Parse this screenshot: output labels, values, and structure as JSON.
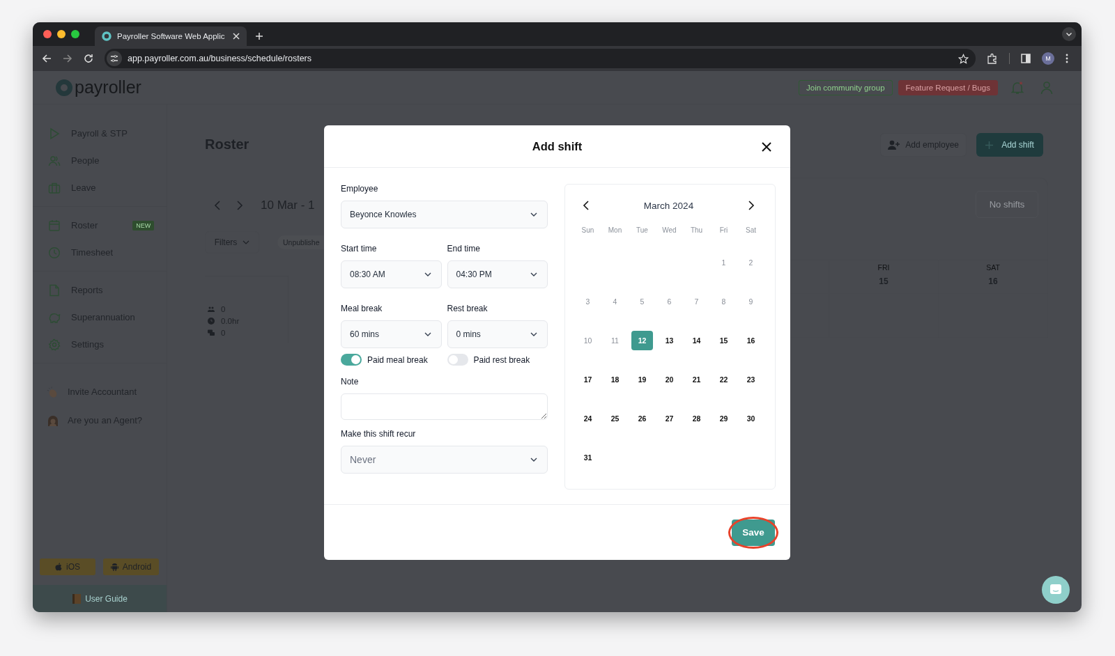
{
  "browser": {
    "tab_title": "Payroller Software Web Applic",
    "url": "app.payroller.com.au/business/schedule/rosters",
    "profile_initial": "M"
  },
  "topbar": {
    "logo": "payroller",
    "buttons": [
      {
        "label": "Join community group",
        "kind": "outline"
      },
      {
        "label": "Feature Request / Bugs",
        "kind": "danger"
      }
    ]
  },
  "sidebar": {
    "sections": [
      {
        "items": [
          {
            "label": "Payroll & STP"
          },
          {
            "label": "People"
          },
          {
            "label": "Leave"
          }
        ]
      },
      {
        "items": [
          {
            "label": "Roster",
            "badge": "NEW"
          },
          {
            "label": "Timesheet"
          }
        ]
      },
      {
        "items": [
          {
            "label": "Reports"
          },
          {
            "label": "Superannuation"
          },
          {
            "label": "Settings"
          }
        ]
      },
      {
        "items": [
          {
            "label": "Invite Accountant"
          },
          {
            "label": "Are you an Agent?"
          }
        ]
      }
    ],
    "apps": [
      "iOS",
      "Android"
    ],
    "guide": "User Guide"
  },
  "roster": {
    "title": "Roster",
    "date_range": "10 Mar - 1",
    "filters": "Filters",
    "chip": "Unpublishe",
    "stats": [
      "0",
      "0.0hr",
      "0"
    ],
    "add_employee": "Add employee",
    "add_shift": "Add shift",
    "empty": "No shifts",
    "days": [
      {
        "dow": "FRI",
        "date": "15"
      },
      {
        "dow": "SAT",
        "date": "16"
      }
    ]
  },
  "modal": {
    "title": "Add shift",
    "employee": {
      "label": "Employee",
      "value": "Beyonce Knowles"
    },
    "times": [
      {
        "label": "Start time",
        "value": "08:30 AM"
      },
      {
        "label": "End time",
        "value": "04:30 PM"
      }
    ],
    "breaks": [
      {
        "label": "Meal break",
        "value": "60 mins"
      },
      {
        "label": "Rest break",
        "value": "0 mins"
      }
    ],
    "toggles": [
      {
        "label": "Paid meal break",
        "on": true
      },
      {
        "label": "Paid rest break",
        "on": false
      }
    ],
    "note": {
      "label": "Note"
    },
    "recur": {
      "label": "Make this shift recur",
      "placeholder": "Never"
    },
    "calendar": {
      "month": "March 2024",
      "weekdays": [
        "Sun",
        "Mon",
        "Tue",
        "Wed",
        "Thu",
        "Fri",
        "Sat"
      ],
      "weeks": [
        {
          "right_aligned": true,
          "days": [
            {
              "d": "1",
              "past": true,
              "selected": false
            },
            {
              "d": "2",
              "past": true,
              "selected": false
            }
          ]
        },
        {
          "days": [
            {
              "d": "3",
              "past": true,
              "selected": false
            },
            {
              "d": "4",
              "past": true,
              "selected": false
            },
            {
              "d": "5",
              "past": true,
              "selected": false
            },
            {
              "d": "6",
              "past": true,
              "selected": false
            },
            {
              "d": "7",
              "past": true,
              "selected": false
            },
            {
              "d": "8",
              "past": true,
              "selected": false
            },
            {
              "d": "9",
              "past": true,
              "selected": false
            }
          ]
        },
        {
          "days": [
            {
              "d": "10",
              "past": true,
              "selected": false
            },
            {
              "d": "11",
              "past": true,
              "selected": false
            },
            {
              "d": "12",
              "past": false,
              "selected": true
            },
            {
              "d": "13",
              "past": false,
              "selected": false
            },
            {
              "d": "14",
              "past": false,
              "selected": false
            },
            {
              "d": "15",
              "past": false,
              "selected": false
            },
            {
              "d": "16",
              "past": false,
              "selected": false
            }
          ]
        },
        {
          "days": [
            {
              "d": "17",
              "past": false,
              "selected": false
            },
            {
              "d": "18",
              "past": false,
              "selected": false
            },
            {
              "d": "19",
              "past": false,
              "selected": false
            },
            {
              "d": "20",
              "past": false,
              "selected": false
            },
            {
              "d": "21",
              "past": false,
              "selected": false
            },
            {
              "d": "22",
              "past": false,
              "selected": false
            },
            {
              "d": "23",
              "past": false,
              "selected": false
            }
          ]
        },
        {
          "days": [
            {
              "d": "24",
              "past": false,
              "selected": false
            },
            {
              "d": "25",
              "past": false,
              "selected": false
            },
            {
              "d": "26",
              "past": false,
              "selected": false
            },
            {
              "d": "27",
              "past": false,
              "selected": false
            },
            {
              "d": "28",
              "past": false,
              "selected": false
            },
            {
              "d": "29",
              "past": false,
              "selected": false
            },
            {
              "d": "30",
              "past": false,
              "selected": false
            }
          ]
        },
        {
          "right_aligned": false,
          "days": [
            {
              "d": "31",
              "past": false,
              "selected": false
            }
          ]
        }
      ]
    },
    "save": {
      "label": "Save",
      "highlighted": true
    }
  }
}
